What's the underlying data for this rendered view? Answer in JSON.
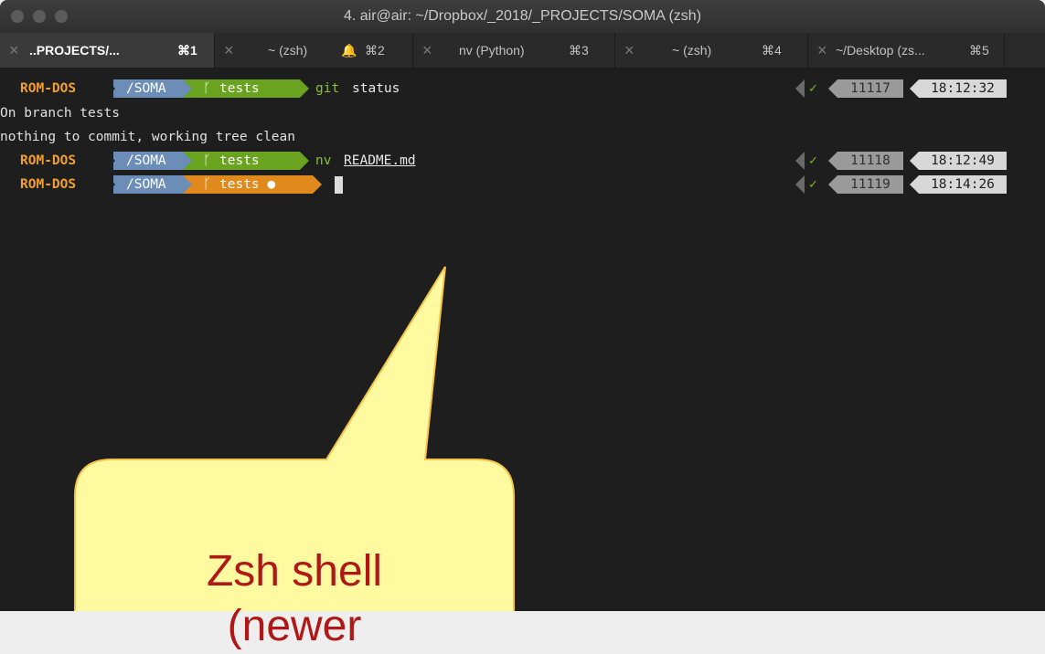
{
  "window": {
    "title": "4. air@air: ~/Dropbox/_2018/_PROJECTS/SOMA (zsh)"
  },
  "tabs": [
    {
      "label": "..PROJECTS/...",
      "shortcut": "⌘1",
      "active": true
    },
    {
      "label": "~ (zsh)",
      "shortcut": "⌘2",
      "active": false
    },
    {
      "label": "nv (Python)",
      "shortcut": "⌘3",
      "active": false
    },
    {
      "label": "~ (zsh)",
      "shortcut": "⌘4",
      "active": false
    },
    {
      "label": "~/Desktop (zs...",
      "shortcut": "⌘5",
      "active": false
    }
  ],
  "terminal": {
    "prompts": [
      {
        "host": "ROM-DOS",
        "dir": "/SOMA",
        "branch": "tests",
        "branch_state": "clean",
        "command_name": "git",
        "command_arg": "status",
        "history": "11117",
        "time": "18:12:32",
        "status": "✓"
      },
      {
        "host": "ROM-DOS",
        "dir": "/SOMA",
        "branch": "tests",
        "branch_state": "clean",
        "command_name": "nv",
        "command_arg": "README.md",
        "history": "11118",
        "time": "18:12:49",
        "status": "✓"
      },
      {
        "host": "ROM-DOS",
        "dir": "/SOMA",
        "branch": "tests ●",
        "branch_state": "dirty",
        "command_name": "",
        "command_arg": "",
        "history": "11119",
        "time": "18:14:26",
        "status": "✓"
      }
    ],
    "output": [
      "On branch tests",
      "nothing to commit, working tree clean"
    ],
    "branch_glyph": "ᚴ"
  },
  "callout": {
    "text_line1": "Zsh shell",
    "text_line2": "(newer"
  },
  "colors": {
    "host": "#f0a030",
    "dir_segment": "#6b8db8",
    "branch_clean": "#6aa31f",
    "branch_dirty": "#e08a1e",
    "callout_fill": "#fff9a0",
    "callout_border": "#f5c44a",
    "callout_text": "#b01818"
  }
}
